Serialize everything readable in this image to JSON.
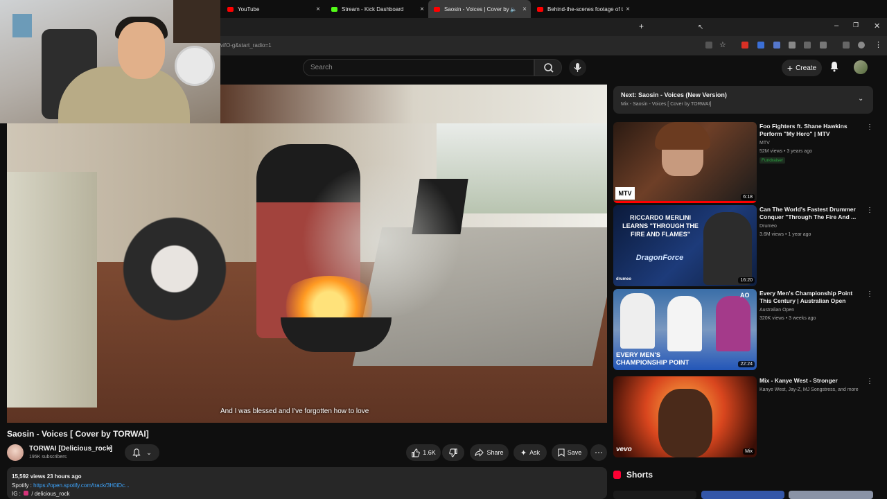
{
  "browser": {
    "tabs": [
      {
        "title": "YouTube",
        "close": "×"
      },
      {
        "title": "Stream - Kick Dashboard",
        "close": "×"
      },
      {
        "title": "Saosin - Voices | Cover by",
        "close": "×",
        "mute": "🔈"
      },
      {
        "title": "Behind-the-scenes footage of t",
        "close": "×"
      }
    ],
    "new_tab": "+",
    "url": "vifO-g&start_radio=1",
    "win_min": "–",
    "win_max": "❐",
    "win_close": "✕"
  },
  "header": {
    "search_placeholder": "Search",
    "create_label": "Create"
  },
  "player": {
    "caption": "And I was blessed and I've forgotten how to love"
  },
  "video": {
    "title": "Saosin - Voices [ Cover by TORWAI]",
    "channel": "TORWAI [Delicious_rock]",
    "subscribers": "195K subscribers",
    "likes": "1.6K",
    "share_label": "Share",
    "ask_label": "Ask",
    "save_label": "Save",
    "views_meta": "15,592 views  23 hours ago",
    "spotify_label": "Spotify :",
    "spotify_link": "https://open.spotify.com/track/3H0iDc...",
    "ig_label": "IG :",
    "ig_handle": "/ delicious_rock"
  },
  "up_next": {
    "title": "Next: Saosin - Voices (New Version)",
    "subtitle": "Mix - Saosin - Voices [ Cover by TORWAI]"
  },
  "recommendations": [
    {
      "title": "Foo Fighters ft. Shane Hawkins Perform \"My Hero\" | MTV",
      "channel": "MTV",
      "meta": "52M views • 3 years ago",
      "badge": "Fundraiser",
      "duration": "6:18"
    },
    {
      "title": "Can The World's Fastest Drummer Conquer \"Through The Fire And ...",
      "channel": "Drumeo",
      "meta": "3.6M views • 1 year ago",
      "duration": "16:20",
      "thumb_text": "RICCARDO MERLINI LEARNS \"THROUGH THE FIRE AND FLAMES\"",
      "thumb_logo": "DragonForce",
      "thumb_brand": "drumeo"
    },
    {
      "title": "Every Men's Championship Point This Century | Australian Open",
      "channel": "Australian Open",
      "meta": "320K views • 3 weeks ago",
      "duration": "22:24",
      "thumb_text": "EVERY MEN'S CHAMPIONSHIP POINT",
      "thumb_brand": "AO"
    },
    {
      "title": "Mix - Kanye West - Stronger",
      "channel": "Kanye West, Jay-Z, MJ Songstress, and more",
      "duration": "Mix",
      "thumb_brand": "vevo"
    }
  ],
  "shorts_label": "Shorts",
  "mtv_logo": "MTV",
  "icons": [
    "search-icon",
    "mic-icon",
    "bell-icon",
    "plus-icon",
    "like-icon",
    "dislike-icon",
    "share-icon",
    "sparkle-icon",
    "save-icon",
    "more-icon",
    "chevron-down-icon",
    "verified-icon"
  ]
}
